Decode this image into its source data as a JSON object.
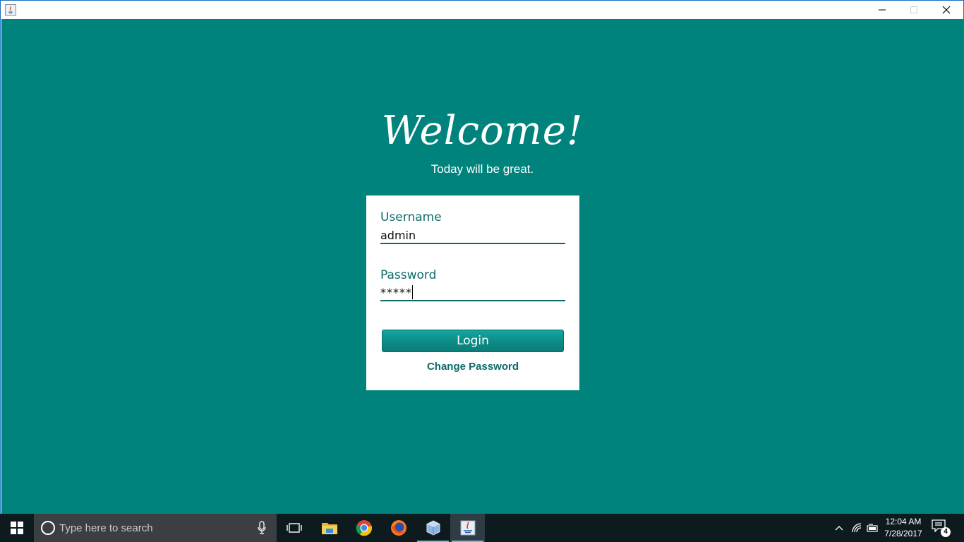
{
  "window": {
    "app_icon": "java-icon",
    "controls": [
      "minimize-icon",
      "maximize-icon",
      "close-icon"
    ]
  },
  "login": {
    "heading": "Welcome!",
    "tagline": "Today will be great.",
    "username_label": "Username",
    "username_value": "admin",
    "password_label": "Password",
    "password_value": "*****",
    "login_button": "Login",
    "change_password_link": "Change Password"
  },
  "colors": {
    "background": "#00837d",
    "accent": "#0b6b68",
    "button": "#0d8b86",
    "card": "#ffffff"
  },
  "taskbar": {
    "search_placeholder": "Type here to search",
    "apps": [
      "task-view-icon",
      "file-explorer-icon",
      "chrome-icon",
      "firefox-icon",
      "virtualbox-icon",
      "java-icon"
    ],
    "time": "12:04 AM",
    "date": "7/28/2017",
    "notification_count": "4"
  }
}
